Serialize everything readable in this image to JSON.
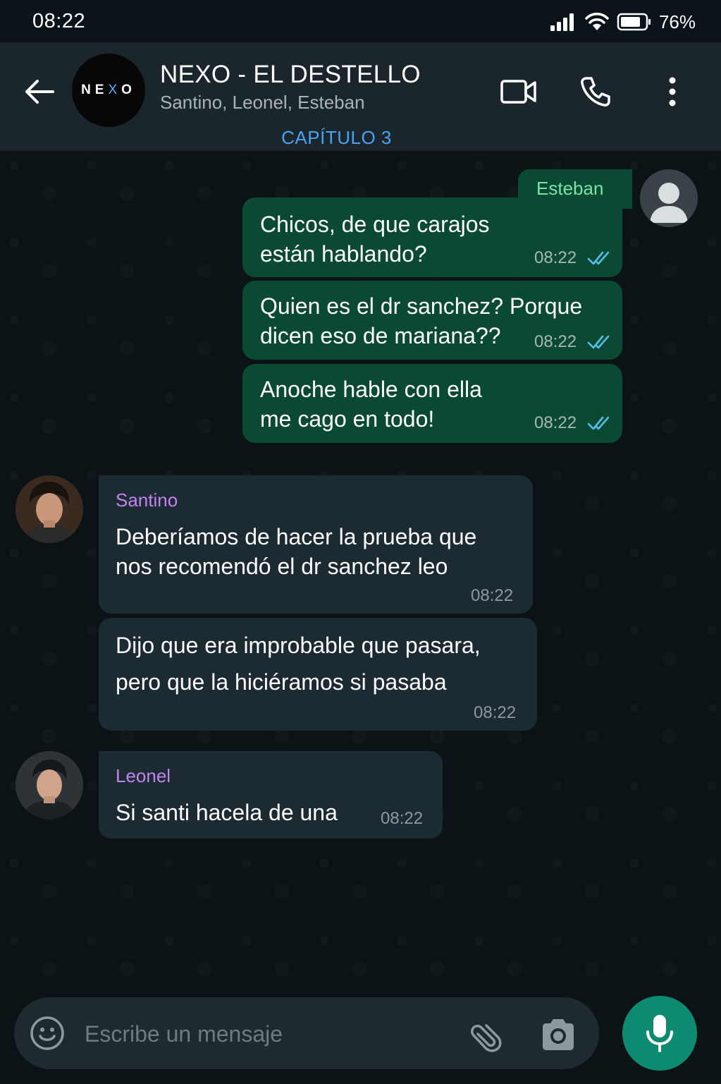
{
  "status_bar": {
    "time": "08:22",
    "battery": "76%"
  },
  "header": {
    "title": "NEXO - EL DESTELLO",
    "members": "Santino, Leonel, Esteban",
    "chapter": "CAPÍTULO 3",
    "logo": {
      "left": "NE",
      "mid": "X",
      "right": "O"
    }
  },
  "messages": {
    "esteban": {
      "sender": "Esteban",
      "items": [
        {
          "text_line1": "Chicos, de que carajos",
          "text_line2": "están hablando?",
          "time": "08:22"
        },
        {
          "text_line1": "Quien es el dr sanchez? Porque",
          "text_line2": "dicen eso de mariana??",
          "time": "08:22"
        },
        {
          "text_line1": "Anoche hable con ella",
          "text_line2": "me cago en todo!",
          "time": "08:22"
        }
      ]
    },
    "santino": {
      "sender": "Santino",
      "items": [
        {
          "text_line1": "Deberíamos de hacer la prueba que",
          "text_line2": "nos recomendó el dr sanchez leo",
          "time": "08:22"
        },
        {
          "text_line1": "Dijo que era improbable que pasara,",
          "text_line2": "pero que la hiciéramos si pasaba",
          "time": "08:22"
        }
      ]
    },
    "leonel": {
      "sender": "Leonel",
      "items": [
        {
          "text": "Si santi hacela de una",
          "time": "08:22"
        }
      ]
    }
  },
  "input": {
    "placeholder": "Escribe un mensaje"
  },
  "colors": {
    "outgoing_bubble": "#0a4a33",
    "incoming_bubble": "#1c2a31",
    "read_ticks": "#53bdeb",
    "mic_button": "#0d8a70",
    "chapter_link": "#4aa3f2"
  },
  "icons": [
    "back-arrow-icon",
    "video-call-icon",
    "phone-icon",
    "more-options-icon",
    "emoji-icon",
    "attach-icon",
    "camera-icon",
    "mic-icon",
    "signal-icon",
    "wifi-icon",
    "battery-icon",
    "double-check-icon"
  ]
}
